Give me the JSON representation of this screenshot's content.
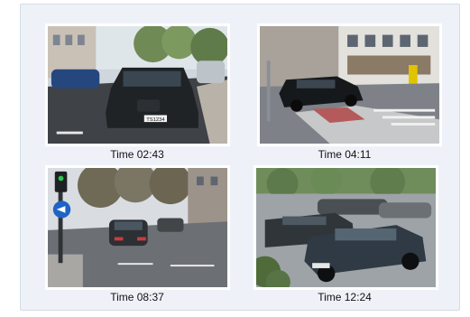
{
  "tiles": [
    {
      "caption": "Time 02:43",
      "plate": "TS1234"
    },
    {
      "caption": "Time 04:11"
    },
    {
      "caption": "Time 08:37"
    },
    {
      "caption": "Time 12:24"
    }
  ]
}
